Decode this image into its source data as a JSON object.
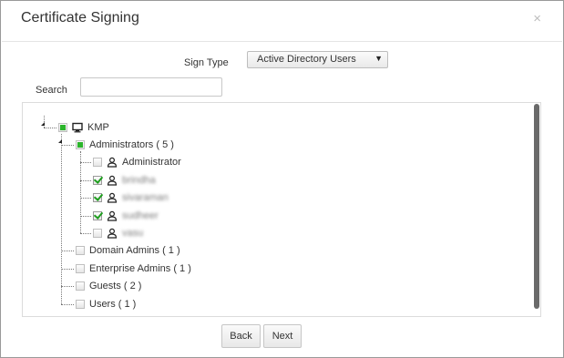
{
  "dialog": {
    "title": "Certificate Signing",
    "close_label": "×"
  },
  "form": {
    "sign_type_label": "Sign Type",
    "sign_type_value": "Active Directory Users",
    "search_label": "Search",
    "search_value": ""
  },
  "tree": {
    "root": {
      "label": "KMP",
      "state": "partial"
    },
    "groups": [
      {
        "label": "Administrators ( 5 )",
        "state": "partial"
      },
      {
        "label": "Domain Admins ( 1 )",
        "state": "unchecked"
      },
      {
        "label": "Enterprise Admins ( 1 )",
        "state": "unchecked"
      },
      {
        "label": "Guests ( 2 )",
        "state": "unchecked"
      },
      {
        "label": "Users ( 1 )",
        "state": "unchecked"
      }
    ],
    "admin_users": [
      {
        "label": "Administrator",
        "state": "unchecked"
      },
      {
        "label": "brindha",
        "state": "checked"
      },
      {
        "label": "sivaraman",
        "state": "checked"
      },
      {
        "label": "sudheer",
        "state": "checked"
      },
      {
        "label": "vasu",
        "state": "unchecked"
      }
    ]
  },
  "buttons": {
    "back": "Back",
    "next": "Next"
  }
}
